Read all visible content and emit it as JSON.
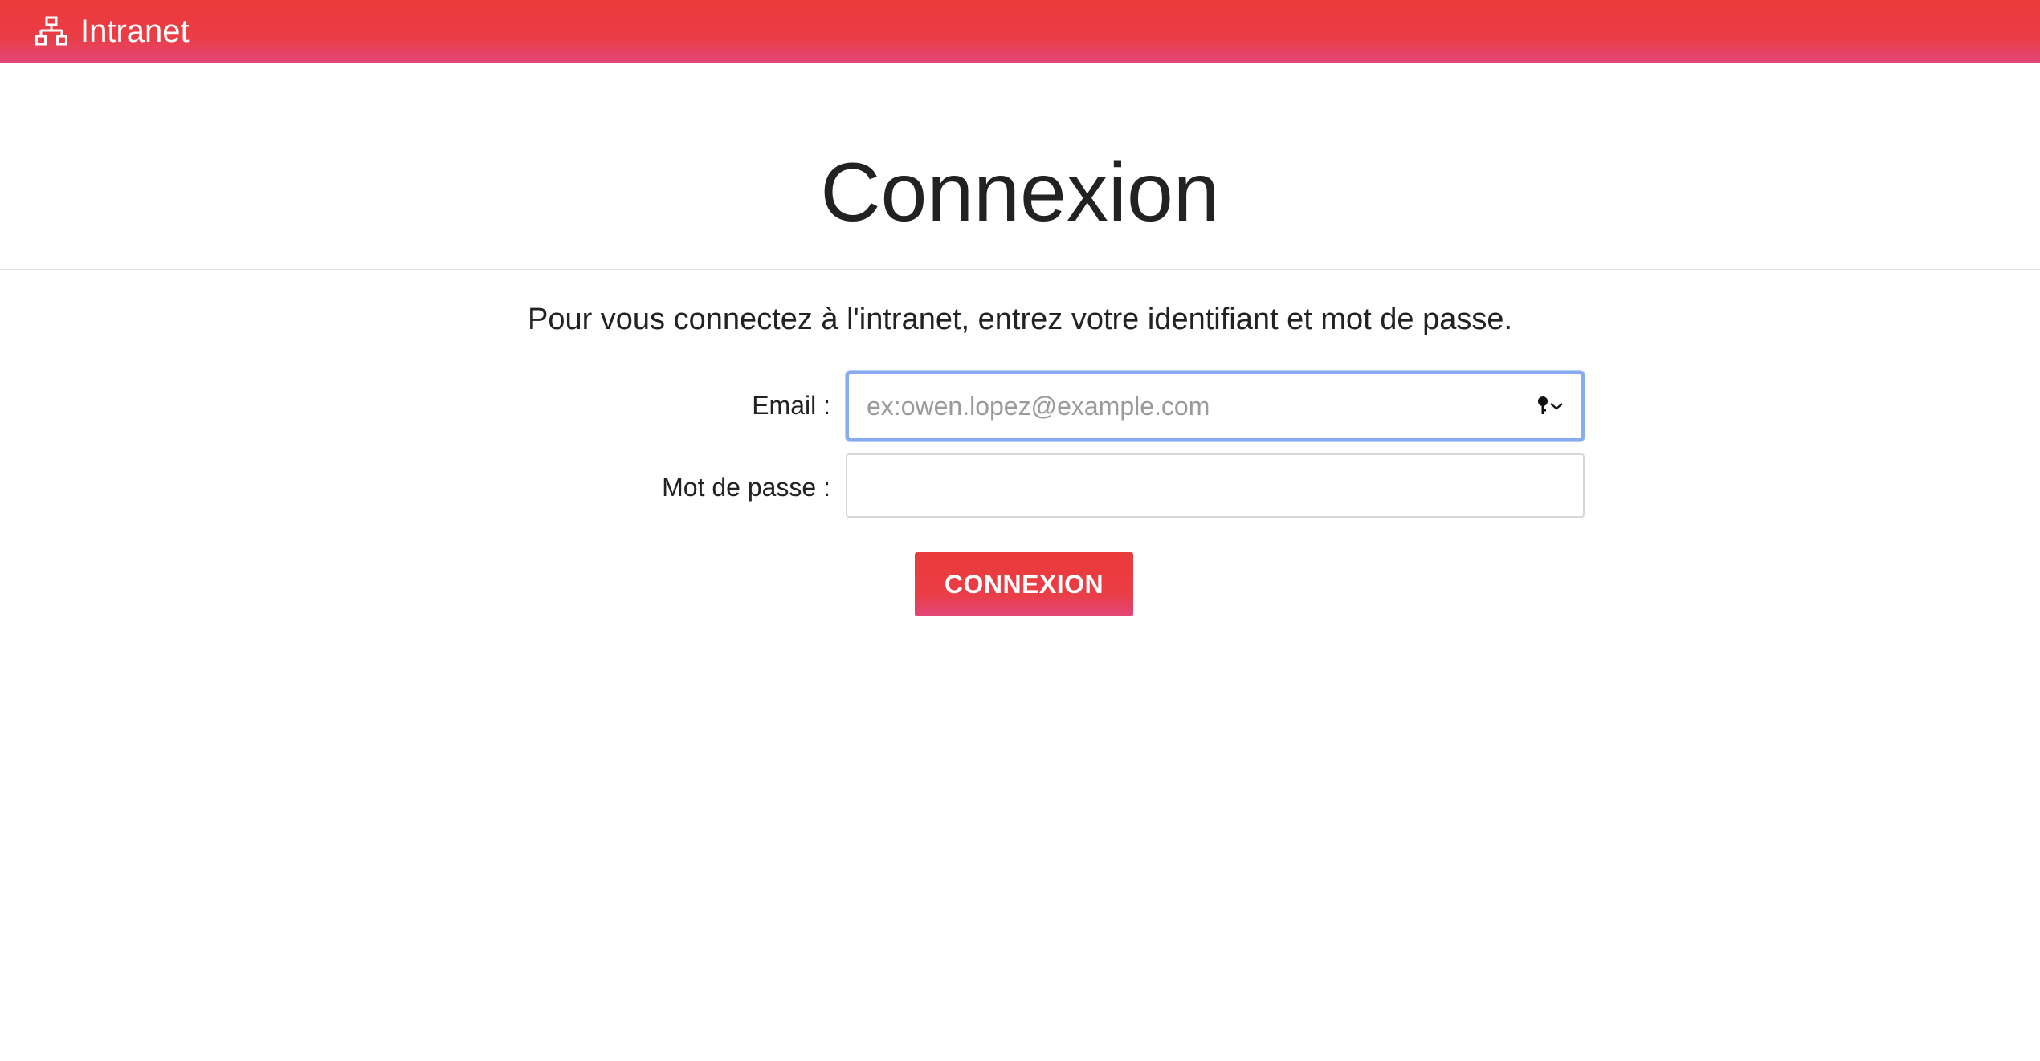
{
  "header": {
    "brand_icon": "sitemap-icon",
    "brand_label": "Intranet",
    "background_color": "#ea3b3b",
    "gradient_bottom_color": "#e2477a"
  },
  "main": {
    "title": "Connexion",
    "instructions": "Pour vous connectez à l'intranet, entrez votre identifiant et mot de passe."
  },
  "form": {
    "email": {
      "label": "Email :",
      "value": "",
      "placeholder": "ex:owen.lopez@example.com",
      "autofill_icon": "key-icon",
      "dropdown_icon": "chevron-down-icon",
      "focused": true
    },
    "password": {
      "label": "Mot de passe :",
      "value": "",
      "placeholder": ""
    },
    "submit_label": "CONNEXION",
    "button_color": "#ea3b3b"
  },
  "colors": {
    "focus_ring": "#87aaf0",
    "text": "#222222",
    "placeholder": "#9a9a9a"
  }
}
